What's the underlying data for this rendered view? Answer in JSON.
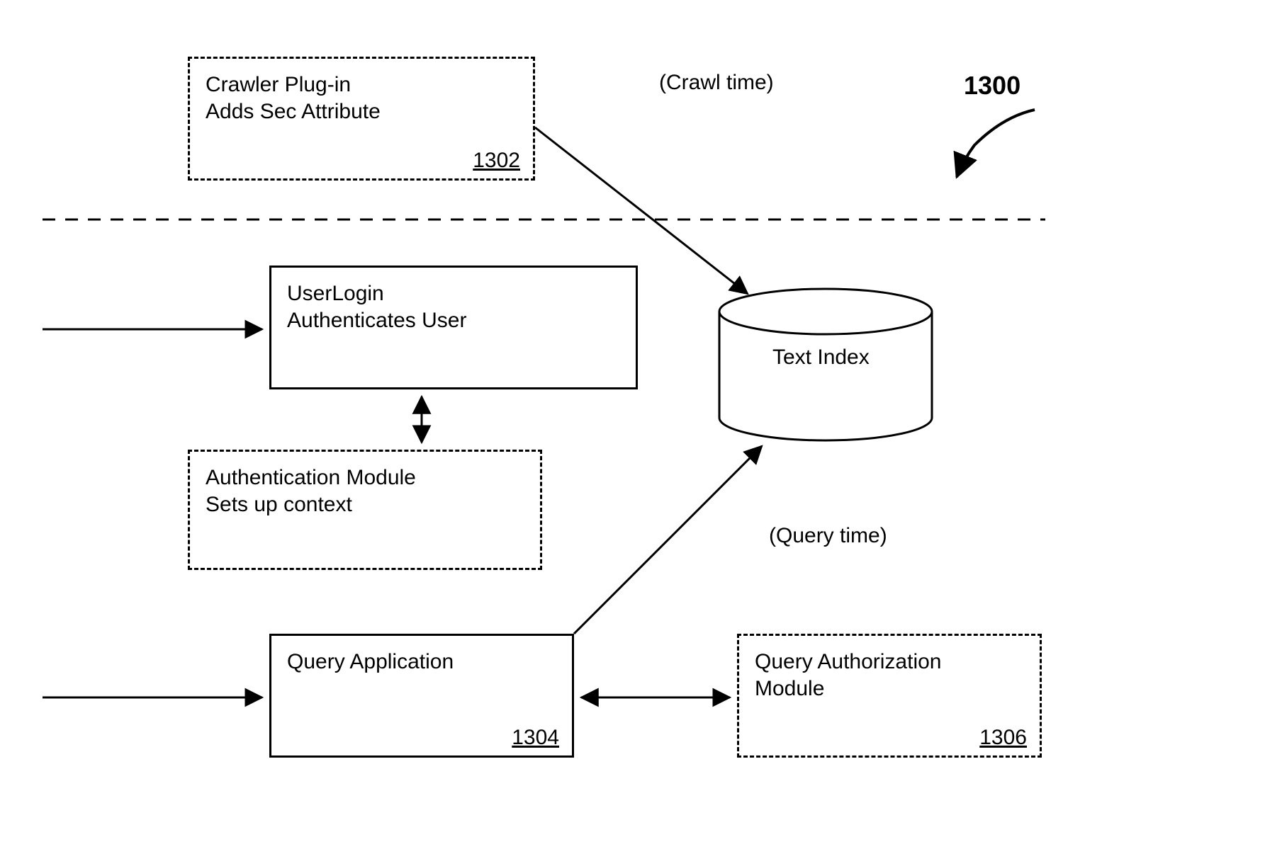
{
  "figure_number": "1300",
  "crawl_time_label": "(Crawl time)",
  "query_time_label": "(Query time)",
  "boxes": {
    "crawler": {
      "line1": "Crawler Plug-in",
      "line2": "Adds Sec Attribute",
      "ref": "1302"
    },
    "userlogin": {
      "line1": "UserLogin",
      "line2": "Authenticates User"
    },
    "authmodule": {
      "line1": "Authentication Module",
      "line2": "Sets up context"
    },
    "queryapp": {
      "line1": "Query Application",
      "ref": "1304"
    },
    "queryauth": {
      "line1": "Query Authorization",
      "line2": "Module",
      "ref": "1306"
    },
    "textindex": {
      "label": "Text Index"
    }
  }
}
